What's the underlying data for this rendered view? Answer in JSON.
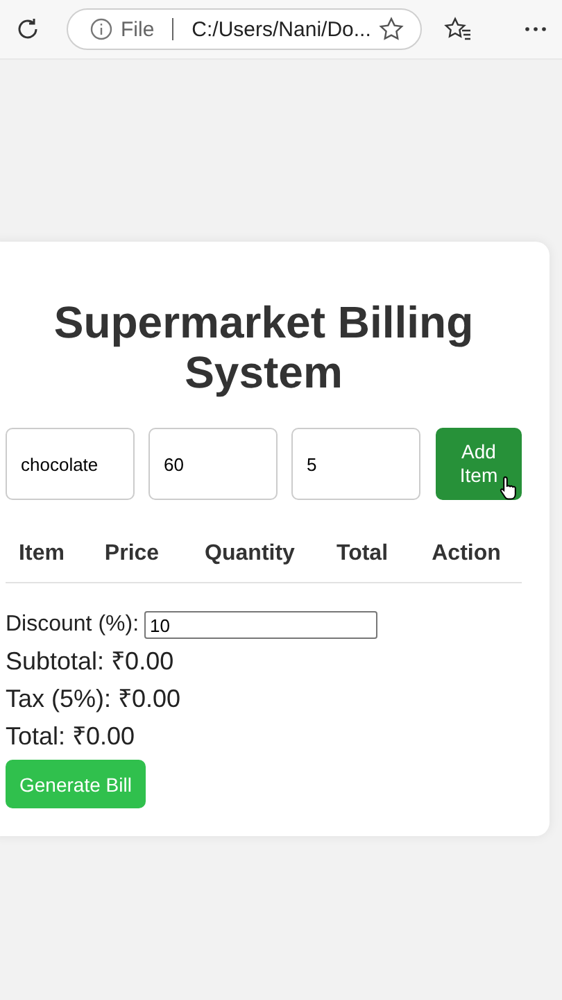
{
  "browser": {
    "address_prefix": "File",
    "address": "C:/Users/Nani/Do..."
  },
  "title": "Supermarket Billing System",
  "inputs": [
    {
      "value": "chocolate"
    },
    {
      "value": "60"
    },
    {
      "value": "5"
    }
  ],
  "add_button": {
    "label": "Add Item",
    "hovered": true
  },
  "table": {
    "columns": [
      "Item",
      "Price",
      "Quantity",
      "Total",
      "Action"
    ]
  },
  "discount": {
    "label": "Discount (%):",
    "value": "10"
  },
  "summary": [
    "Subtotal: ₹0.00",
    "Tax (5%): ₹0.00",
    "Total: ₹0.00"
  ],
  "generate_button": {
    "label": "Generate Bill"
  }
}
